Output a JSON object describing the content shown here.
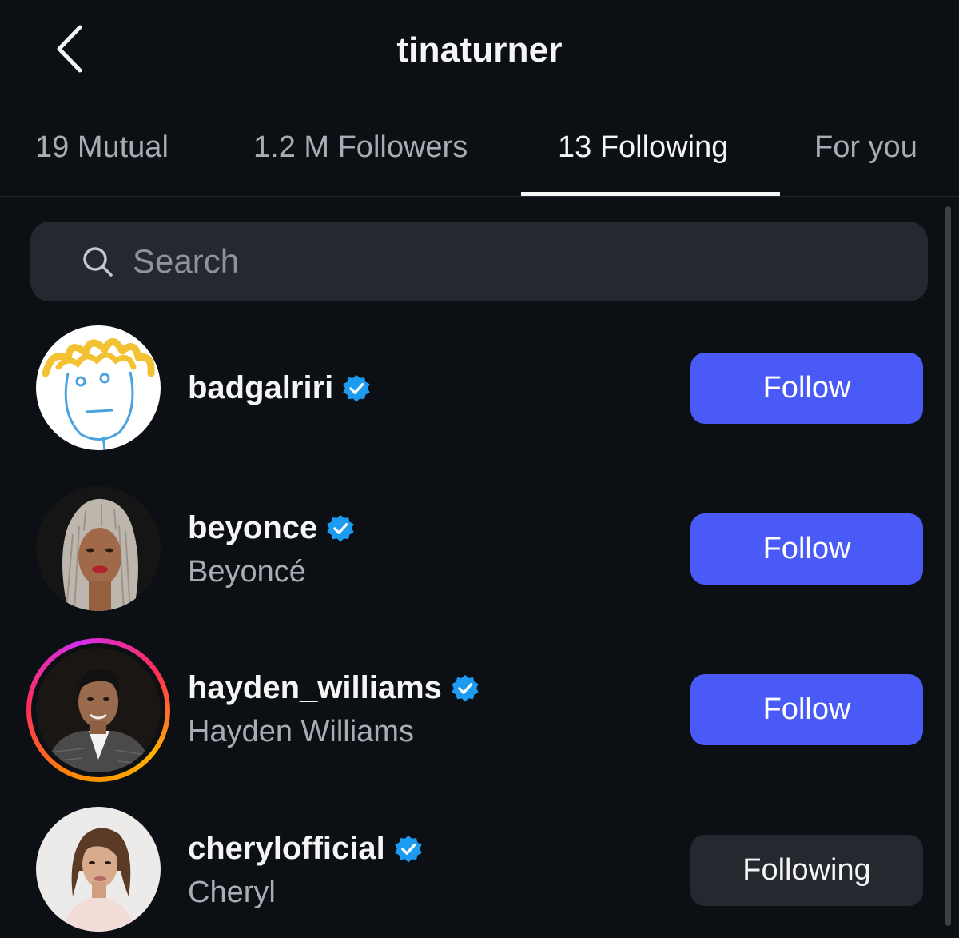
{
  "header": {
    "title": "tinaturner",
    "back_icon": "chevron-left-icon"
  },
  "tabs": [
    {
      "label": "19 Mutual",
      "active": false
    },
    {
      "label": "1.2 M Followers",
      "active": false
    },
    {
      "label": "13 Following",
      "active": true
    },
    {
      "label": "For you",
      "active": false
    }
  ],
  "search": {
    "placeholder": "Search",
    "value": "",
    "icon": "search-icon"
  },
  "accounts": [
    {
      "username": "badgalriri",
      "full_name": "",
      "verified": true,
      "button": "Follow",
      "button_state": "follow",
      "has_story": false
    },
    {
      "username": "beyonce",
      "full_name": "Beyoncé",
      "verified": true,
      "button": "Follow",
      "button_state": "follow",
      "has_story": false
    },
    {
      "username": "hayden_williams",
      "full_name": "Hayden Williams",
      "verified": true,
      "button": "Follow",
      "button_state": "follow",
      "has_story": true
    },
    {
      "username": "cherylofficial",
      "full_name": "Cheryl",
      "verified": true,
      "button": "Following",
      "button_state": "following",
      "has_story": false
    }
  ],
  "colors": {
    "background": "#0c0f14",
    "follow_button": "#4a5af6",
    "following_button": "#25282e",
    "verified_badge": "#1d9bf0",
    "muted_text": "#a8acb3"
  }
}
